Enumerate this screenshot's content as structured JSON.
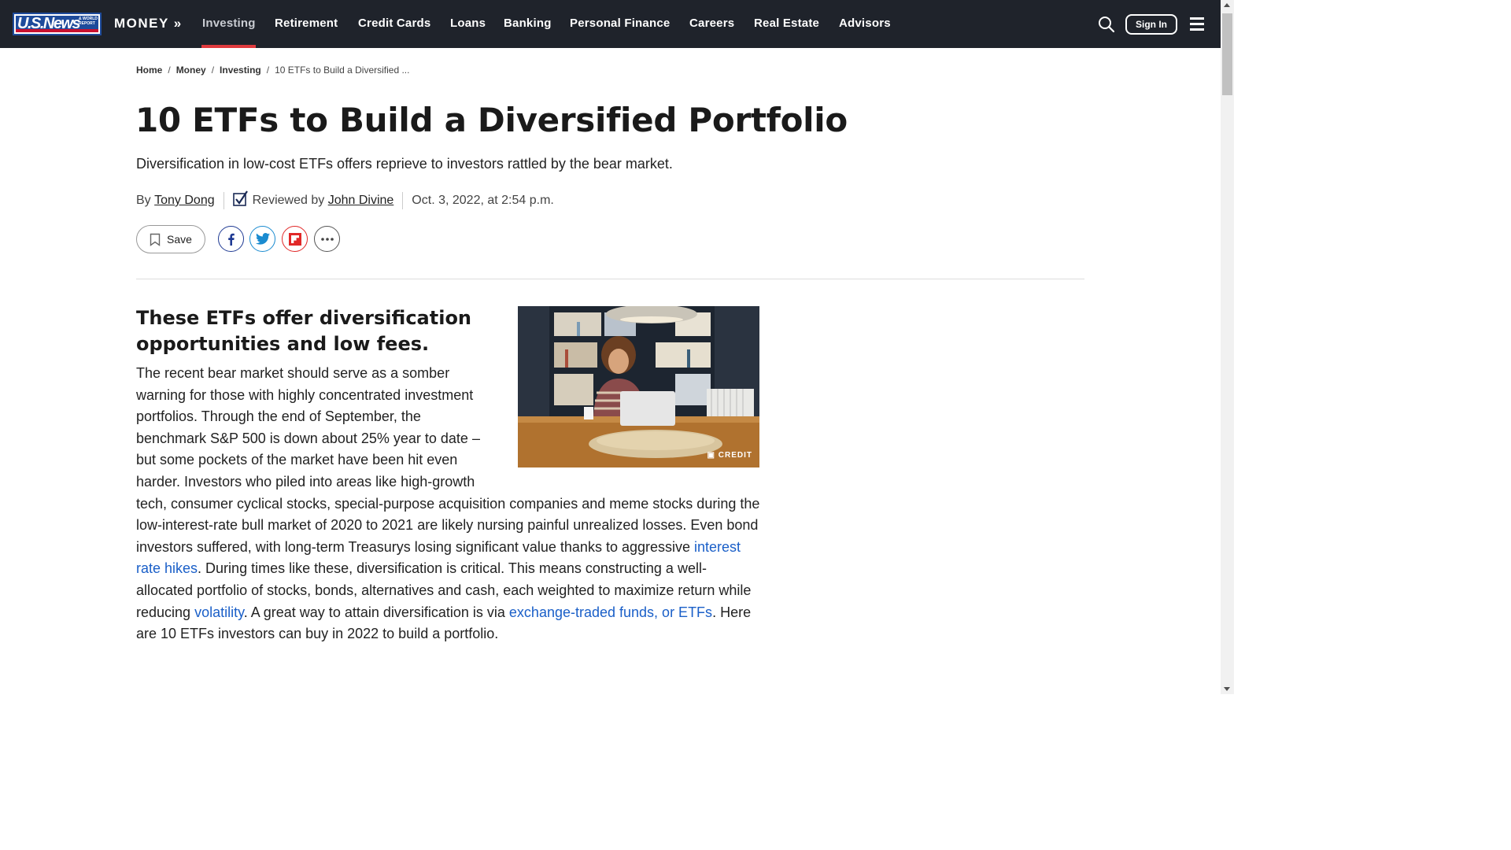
{
  "brand": {
    "logo_text": "U.S.News",
    "logo_small": "& WORLD REPORT",
    "section": "MONEY »"
  },
  "nav": {
    "items": [
      "Investing",
      "Retirement",
      "Credit Cards",
      "Loans",
      "Banking",
      "Personal Finance",
      "Careers",
      "Real Estate",
      "Advisors"
    ],
    "active": "Investing",
    "signin": "Sign In",
    "accent_color": "#e03a3e"
  },
  "breadcrumb": {
    "home": "Home",
    "money": "Money",
    "investing": "Investing",
    "current": "10 ETFs to Build a Diversified ...",
    "sep": "/"
  },
  "article": {
    "title": "10 ETFs to Build a Diversified Portfolio",
    "dek": "Diversification in low-cost ETFs offers reprieve to investors rattled by the bear market.",
    "by": "By",
    "author": "Tony Dong",
    "reviewed_by": "Reviewed by",
    "reviewer": "John Divine",
    "date": "Oct. 3, 2022, at 2:54 p.m.",
    "save": "Save",
    "subhead": "These ETFs offer diversification opportunities and low fees.",
    "photo_credit": "CREDIT",
    "p1": "The recent bear market should serve as a somber warning for those with highly concentrated investment portfolios. Through the end of September, the benchmark S&P 500 is down about 25% year to date – but some pockets of the market have been hit even harder. Investors who piled into areas like high-growth tech, consumer cyclical stocks, special-purpose acquisition companies and meme stocks during the low-interest-rate bull market of 2020 to 2021 are likely nursing painful unrealized losses. Even bond investors suffered, with long-term Treasurys losing significant value thanks to aggressive ",
    "link1": "interest rate hikes",
    "p2": ". During times like these, diversification is critical. This means constructing a well-allocated portfolio of stocks, bonds, alternatives and cash, each weighted to maximize return while reducing ",
    "link2": "volatility",
    "p3": ". A great way to attain diversification is via ",
    "link3": "exchange-traded funds, or ETFs",
    "p4": ". Here are 10 ETFs investors can buy in 2022 to build a portfolio.",
    "link_color": "#1a5fc8"
  },
  "share": {
    "icons": [
      "facebook-icon",
      "twitter-icon",
      "flipboard-icon",
      "more-icon"
    ]
  }
}
